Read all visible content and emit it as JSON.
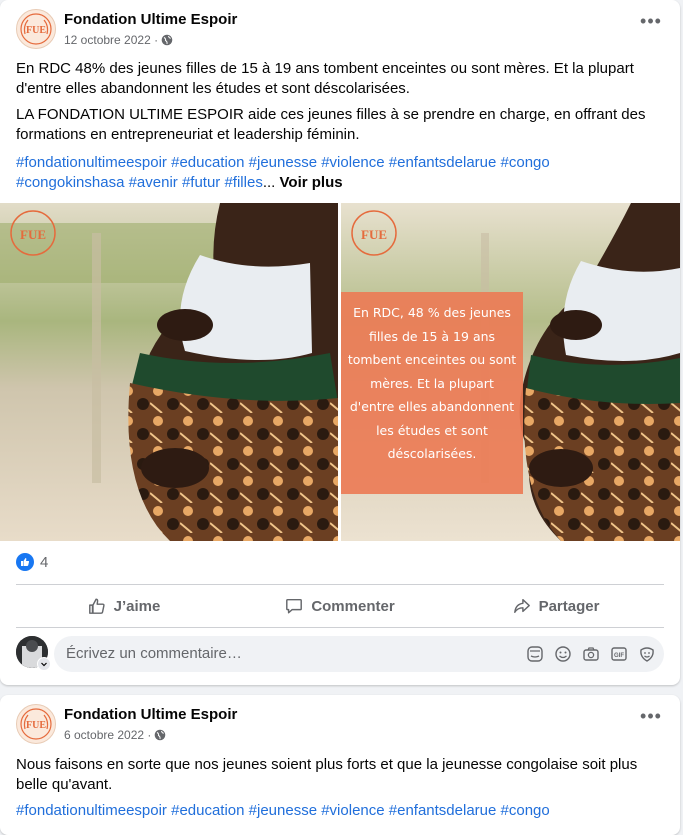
{
  "post1": {
    "author": "Fondation Ultime Espoir",
    "date": "12 octobre 2022 ·",
    "paragraph1": "En RDC 48% des jeunes filles de 15 à 19 ans tombent enceintes ou sont mères. Et la plupart d'entre elles abandonnent les études et sont déscolarisées.",
    "paragraph2": "LA FONDATION ULTIME ESPOIR aide ces jeunes filles à se prendre en charge, en offrant des formations en entrepreneuriat et leadership féminin.",
    "hashtags": "#fondationultimeespoir #education #jeunesse #violence #enfantsdelarue #congo #congokinshasa #avenir #futur #filles",
    "ellipsis": "...",
    "see_more": "Voir plus",
    "overlay_text": "En RDC, 48 % des jeunes filles de 15 à 19 ans tombent enceintes ou sont mères. Et la plupart d'entre elles abandonnent les études et sont déscolarisées.",
    "reaction_count": "4",
    "actions": {
      "like": "J’aime",
      "comment": "Commenter",
      "share": "Partager"
    },
    "comment_placeholder": "Écrivez un commentaire…",
    "logo_text": "FUE"
  },
  "post2": {
    "author": "Fondation Ultime Espoir",
    "date": "6 octobre 2022 ·",
    "paragraph1": "Nous faisons en sorte que nos jeunes soient plus forts et que la jeunesse congolaise soit plus belle qu'avant.",
    "hashtags": "#fondationultimeespoir #education #jeunesse #violence #enfantsdelarue #congo"
  },
  "colors": {
    "link": "#216fdb",
    "brand_accent": "#e56b3d",
    "overlay": "#ec7c56",
    "like_blue": "#1877f2"
  },
  "icons": [
    "globe-icon",
    "more-icon",
    "like-icon",
    "comment-icon",
    "share-icon",
    "sticker-icon",
    "emoji-icon",
    "camera-icon",
    "gif-icon",
    "avatar-sticker-icon"
  ]
}
